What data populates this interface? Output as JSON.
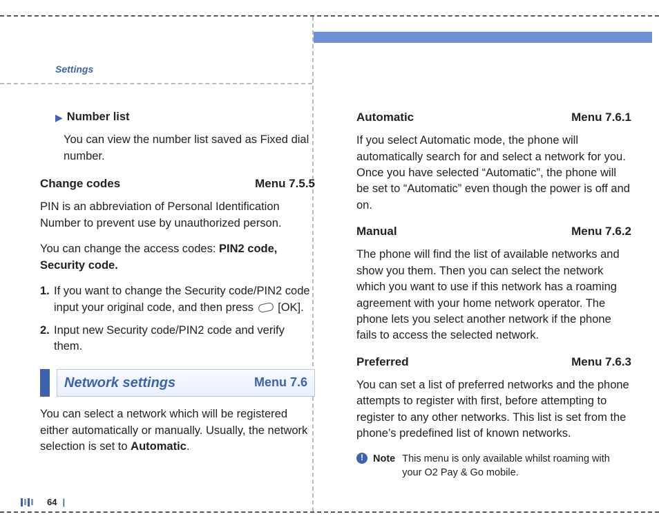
{
  "header": {
    "section_label": "Settings"
  },
  "left": {
    "bullet_title": "Number list",
    "bullet_desc": "You can view the number list saved as Fixed dial number.",
    "h1_title": "Change codes",
    "h1_menu": "Menu 7.5.5",
    "p1": "PIN is an abbreviation of Personal Identification Number to prevent use by unauthorized person.",
    "p2_a": "You can change the access codes: ",
    "p2_b": "PIN2 code, Security code.",
    "step1_a": "If you want to change the Security code/PIN2 code input your original code, and then press ",
    "step1_b": " [OK].",
    "step2": "Input new Security code/PIN2 code and verify them.",
    "section_title": "Network settings",
    "section_menu": "Menu 7.6",
    "p3_a": "You can select a network which will be registered either automatically or manually. Usually, the network selection is set to ",
    "p3_b": "Automatic",
    "p3_c": "."
  },
  "right": {
    "h1_title": "Automatic",
    "h1_menu": "Menu 7.6.1",
    "p1": "If you select Automatic mode, the phone will automatically search for and select a network for you. Once you have selected “Automatic”, the phone will be set to “Automatic” even though the power is off and on.",
    "h2_title": "Manual",
    "h2_menu": "Menu 7.6.2",
    "p2": "The phone will find the list of available networks and show you them. Then you can select the network which you want to use if this network has a roaming agreement with your home network operator. The phone lets you select another network if the phone fails to access the selected network.",
    "h3_title": "Preferred",
    "h3_menu": "Menu 7.6.3",
    "p3": "You can set a list of preferred networks and the phone attempts to register with first, before attempting to register to any other networks. This list is set from the phone’s predefined list of known networks.",
    "note_label": "Note",
    "note_text": "This menu is only available whilst roaming with your O2 Pay & Go mobile."
  },
  "footer": {
    "page_number": "64"
  }
}
